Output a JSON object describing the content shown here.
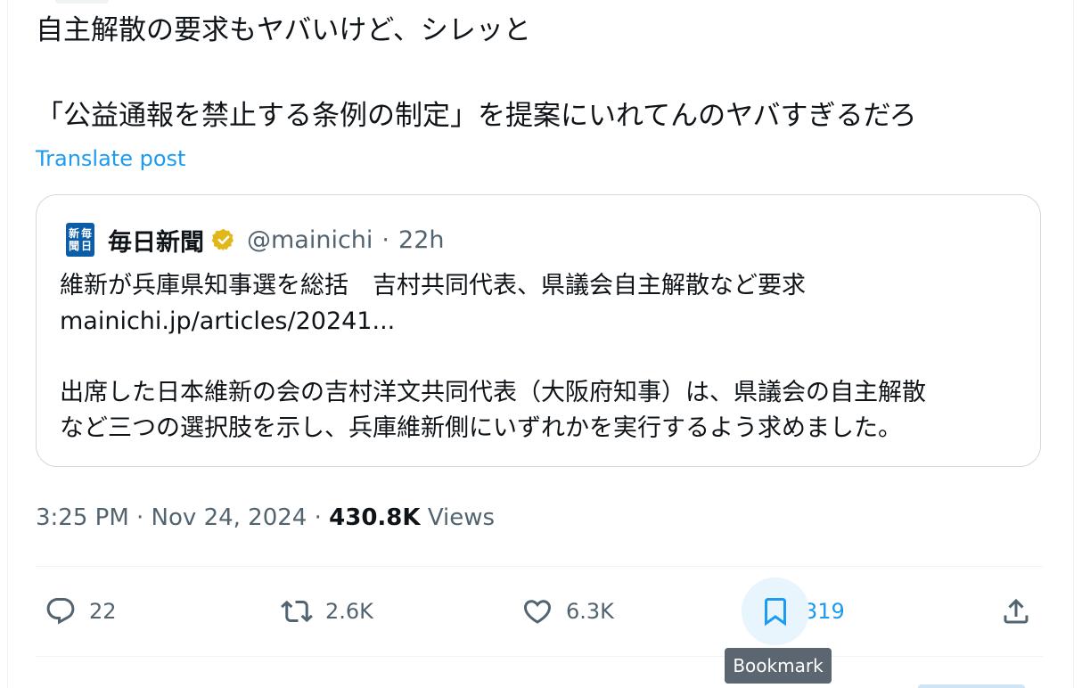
{
  "tweet": {
    "lines": [
      "自主解散の要求もヤバいけど、シレッと",
      "",
      "「公益通報を禁止する条例の制定」を提案にいれてんのヤバすぎるだろ"
    ],
    "translate_label": "Translate post"
  },
  "quote": {
    "logo_chars": [
      "新",
      "毎",
      "聞",
      "日"
    ],
    "name": "毎日新聞",
    "verified_icon": "gold-verified-badge",
    "handle": "@mainichi",
    "separator": "·",
    "time": "22h",
    "lines": [
      "維新が兵庫県知事選を総括　吉村共同代表、県議会自主解散など要求",
      "mainichi.jp/articles/20241...",
      "",
      "出席した日本維新の会の吉村洋文共同代表（大阪府知事）は、県議会の自主解散",
      "など三つの選択肢を示し、兵庫維新側にいずれかを実行するよう求めました。"
    ]
  },
  "meta": {
    "timestamp": "3:25 PM · Nov 24, 2024",
    "separator": "·",
    "views_count": "430.8K",
    "views_label": "Views"
  },
  "actions": {
    "reply": {
      "icon": "reply-icon",
      "count": "22"
    },
    "repost": {
      "icon": "repost-icon",
      "count": "2.6K"
    },
    "like": {
      "icon": "heart-icon",
      "count": "6.3K"
    },
    "bookmark": {
      "icon": "bookmark-icon",
      "count": "319"
    },
    "share": {
      "icon": "share-icon"
    }
  },
  "tooltip": {
    "text": "Bookmark"
  },
  "colors": {
    "accent": "#1d9bf0",
    "secondary_text": "#536471",
    "border": "#cfd9de",
    "verified_gold": "#e2b719",
    "tooltip_bg": "#5b6671"
  }
}
